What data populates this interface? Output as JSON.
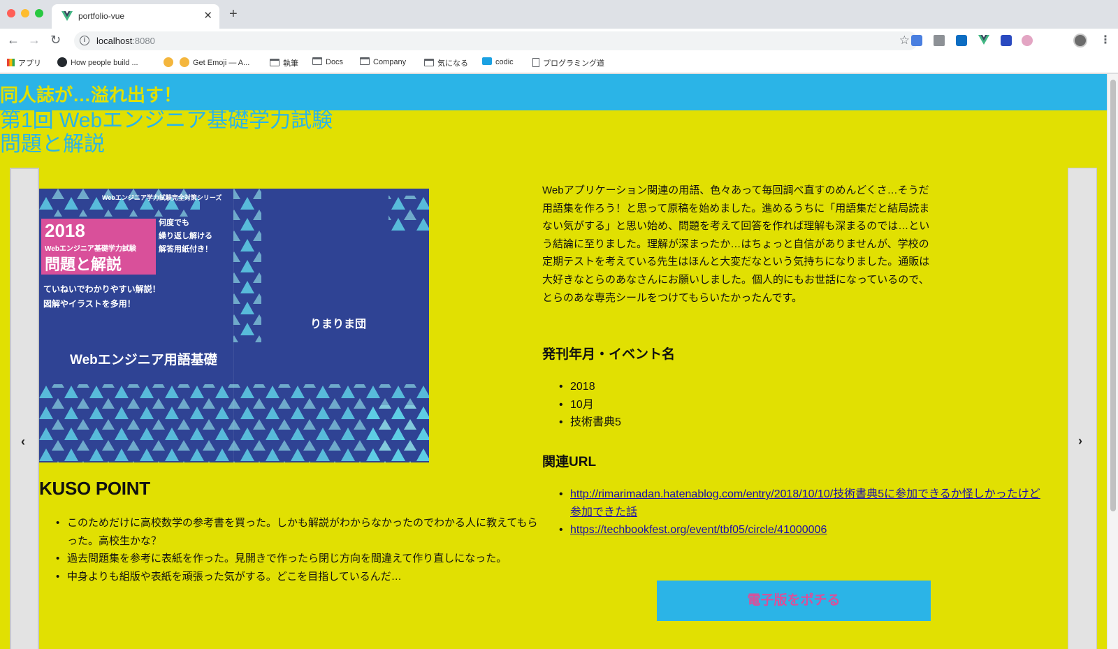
{
  "browser": {
    "tab_title": "portfolio-vue",
    "url_host": "localhost",
    "url_port": ":8080",
    "bookmarks": [
      {
        "label": "アプリ",
        "icon": "apps-grid-icon"
      },
      {
        "label": "How people build ...",
        "icon": "github-icon"
      },
      {
        "label": "",
        "icon": "emoji-icon"
      },
      {
        "label": "Get Emoji — A...",
        "icon": "emoji-icon"
      },
      {
        "label": "執筆",
        "icon": "folder-icon"
      },
      {
        "label": "Docs",
        "icon": "folder-icon"
      },
      {
        "label": "Company",
        "icon": "folder-icon"
      },
      {
        "label": "気になる",
        "icon": "folder-icon"
      },
      {
        "label": "codic",
        "icon": "codic-icon"
      },
      {
        "label": "プログラミング道",
        "icon": "page-icon"
      }
    ]
  },
  "site": {
    "title": "同人誌が…溢れ出す！"
  },
  "work": {
    "title_line1": "第1回 Webエンジニア基礎学力試験",
    "title_line2": "問題と解説",
    "cover": {
      "series": "Webエンジニア学力試験完全対策シリーズ",
      "year": "2018",
      "exam_name": "Webエンジニア基礎学力試験",
      "book_title": "問題と解説",
      "side_line1": "何度でも",
      "side_line2": "繰り返し解ける",
      "side_line3": "解答用紙付き！",
      "desc_line1": "ていねいでわかりやすい解説！",
      "desc_line2": "図解やイラストを多用！",
      "author": "りまりま団",
      "subject": "Webエンジニア用語基礎"
    },
    "kuso_title": "KUSO POINT",
    "kuso_points": [
      "このためだけに高校数学の参考書を買った。しかも解説がわからなかったのでわかる人に教えてもらった。高校生かな？",
      "過去問題集を参考に表紙を作った。見開きで作ったら閉じ方向を間違えて作り直しになった。",
      "中身よりも組版や表紙を頑張った気がする。どこを目指しているんだ…"
    ],
    "description": "Webアプリケーション関連の用語、色々あって毎回調べ直すのめんどくさ…そうだ用語集を作ろう！と思って原稿を始めました。進めるうちに「用語集だと結局読まない気がする」と思い始め、問題を考えて回答を作れば理解も深まるのでは…という結論に至りました。理解が深まったか…はちょっと自信がありませんが、学校の定期テストを考えている先生はほんと大変だなという気持ちになりました。通販は大好きなとらのあなさんにお願いしました。個人的にもお世話になっているので、とらのあな専売シールをつけてもらいたかったんです。",
    "event_heading": "発刊年月・イベント名",
    "event_items": [
      "2018",
      "10月",
      "技術書典5"
    ],
    "url_heading": "関連URL",
    "urls": [
      "http://rimarimadan.hatenablog.com/entry/2018/10/10/技術書典5に参加できるか怪しかったけど参加できた話",
      "https://techbookfest.org/event/tbf05/circle/41000006"
    ],
    "buy_label": "電子版をポチる"
  },
  "colors": {
    "page_bg": "#e1e002",
    "accent_blue": "#2bb4e7",
    "accent_pink": "#d9509a",
    "cover_navy": "#2f4394"
  }
}
